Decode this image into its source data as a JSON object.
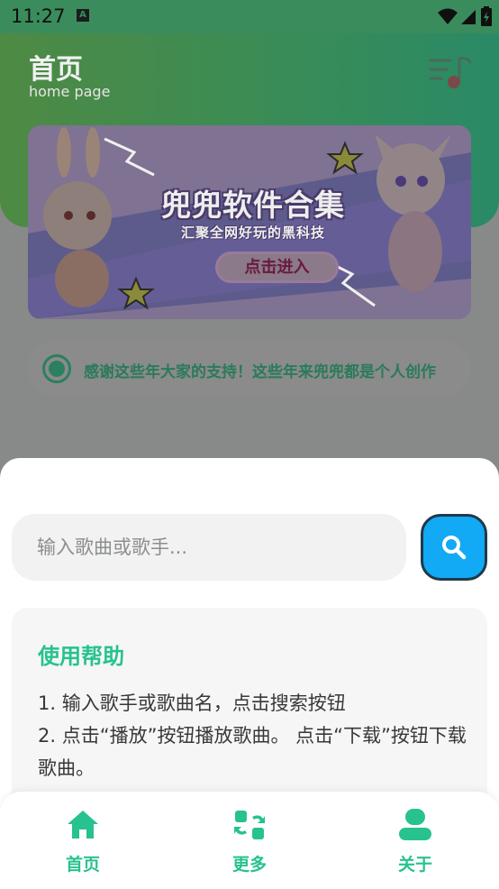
{
  "status_bar": {
    "time": "11:27",
    "notification_badge": "A",
    "icons": [
      "wifi-icon",
      "signal-icon",
      "battery-icon"
    ]
  },
  "header": {
    "title": "首页",
    "subtitle": "home page",
    "menu_icon": "music-menu-icon"
  },
  "banner": {
    "title": "兜兜软件合集",
    "subtitle": "汇聚全网好玩的黑科技",
    "button_label": "点击进入"
  },
  "notice": {
    "text": "感谢这些年大家的支持！这些年来兜兜都是个人创作"
  },
  "search": {
    "placeholder": "输入歌曲或歌手...",
    "value": "",
    "button_icon": "search-icon"
  },
  "help": {
    "title": "使用帮助",
    "lines": [
      "1. 输入歌手或歌曲名，点击搜索按钮",
      "2. 点击“播放”按钮播放歌曲。 点击“下载”按钮下载歌曲。"
    ]
  },
  "bottom_nav": {
    "items": [
      {
        "label": "首页",
        "icon": "home-icon"
      },
      {
        "label": "更多",
        "icon": "grid-refresh-icon"
      },
      {
        "label": "关于",
        "icon": "user-icon"
      }
    ]
  },
  "colors": {
    "accent": "#27c28f",
    "search_button": "#12a9f5",
    "scrim_bg": "#888a89"
  }
}
